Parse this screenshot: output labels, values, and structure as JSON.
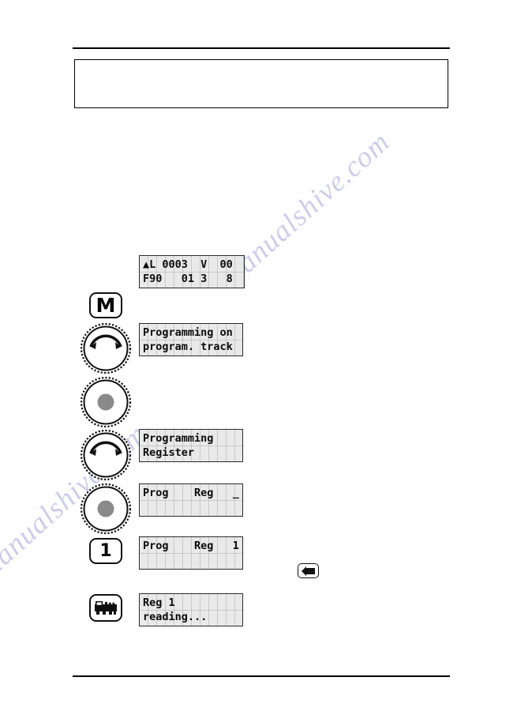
{
  "page": {
    "kind": "manual-page",
    "background_color": "#ffffff",
    "rule_color": "#000000",
    "callout_box": {
      "name": "empty-note-box",
      "text": ""
    }
  },
  "watermark": {
    "line_a": "manualshive.com",
    "line_b": "manualshive.com",
    "color": "#5f5fbf"
  },
  "lcd": {
    "background_color": "#e9e9e9",
    "text_color": "#0a0a0a",
    "border_color": "#2a2a2a"
  },
  "sequence": {
    "steps": [
      {
        "id": "step-0",
        "control": null,
        "display": {
          "name": "lcd-loco-status",
          "line1": "▲L 0003  V  00",
          "line2": "F90   01 3   8"
        }
      },
      {
        "id": "step-1",
        "control": {
          "type": "key",
          "name": "menu-key",
          "label": "M"
        },
        "display": null
      },
      {
        "id": "step-2",
        "control": {
          "type": "knob-turn",
          "name": "rotary-knob-turn",
          "label": ""
        },
        "display": {
          "name": "lcd-programming-on-track",
          "line1": "Programming on",
          "line2": "program. track"
        }
      },
      {
        "id": "step-3",
        "control": {
          "type": "knob-press",
          "name": "rotary-knob-press",
          "label": ""
        },
        "display": null
      },
      {
        "id": "step-4",
        "control": {
          "type": "knob-turn",
          "name": "rotary-knob-turn",
          "label": ""
        },
        "display": {
          "name": "lcd-programming-register",
          "line1": "Programming",
          "line2": "Register"
        }
      },
      {
        "id": "step-5",
        "control": {
          "type": "knob-press",
          "name": "rotary-knob-press",
          "label": ""
        },
        "display": {
          "name": "lcd-prog-reg-empty",
          "line1": "Prog    Reg   _",
          "line2": ""
        }
      },
      {
        "id": "step-6",
        "control": {
          "type": "key",
          "name": "digit-1-key",
          "label": "1"
        },
        "display": {
          "name": "lcd-prog-reg-1",
          "line1": "Prog    Reg   1",
          "line2": ""
        },
        "extra": {
          "type": "enter-key",
          "name": "enter-key",
          "label": ""
        }
      },
      {
        "id": "step-7",
        "control": {
          "type": "key",
          "name": "locomotive-key",
          "label": ""
        },
        "display": {
          "name": "lcd-reg-1-reading",
          "line1": "Reg 1",
          "line2": "reading..."
        }
      }
    ]
  }
}
